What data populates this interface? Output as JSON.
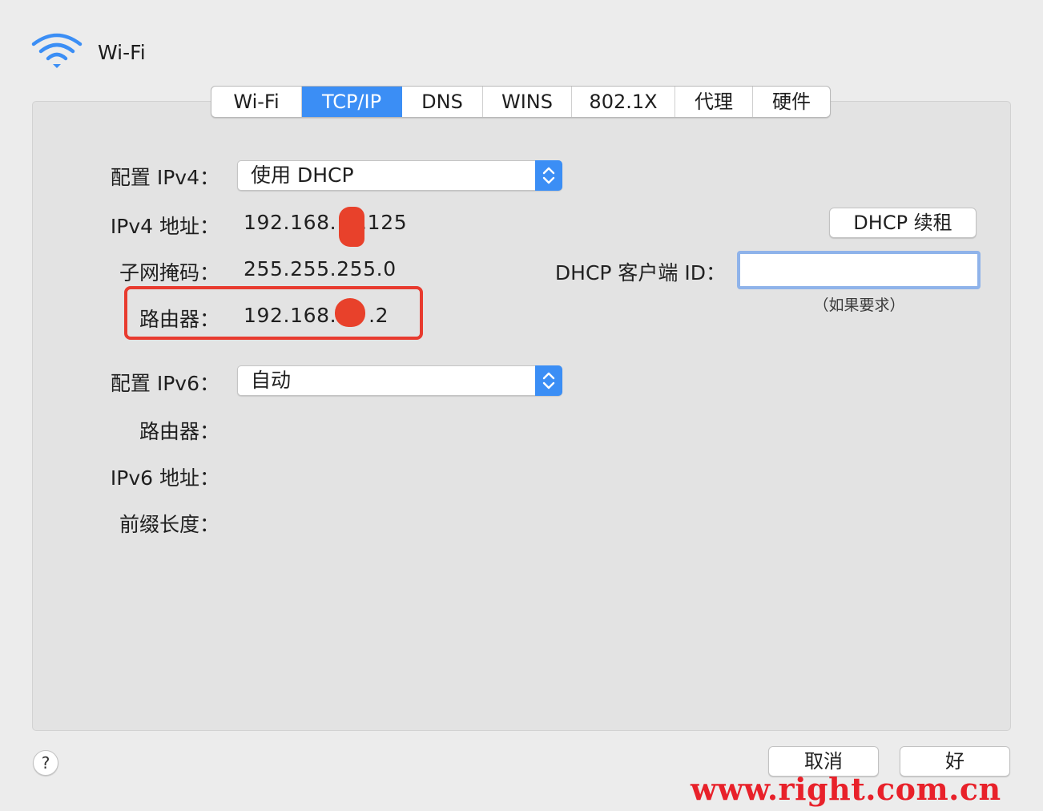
{
  "header": {
    "title": "Wi-Fi",
    "icon": "wifi-icon",
    "accent": "#3b8ef5"
  },
  "tabs": [
    {
      "label": "Wi-Fi",
      "active": false
    },
    {
      "label": "TCP/IP",
      "active": true
    },
    {
      "label": "DNS",
      "active": false
    },
    {
      "label": "WINS",
      "active": false
    },
    {
      "label": "802.1X",
      "active": false
    },
    {
      "label": "代理",
      "active": false
    },
    {
      "label": "硬件",
      "active": false
    }
  ],
  "ipv4": {
    "configure_label": "配置 IPv4：",
    "configure_value": "使用 DHCP",
    "address_label": "IPv4 地址：",
    "address_prefix": "192.168.",
    "address_suffix": ".125",
    "subnet_label": "子网掩码：",
    "subnet_value": "255.255.255.0",
    "router_label": "路由器：",
    "router_prefix": "192.168.",
    "router_suffix": ".2"
  },
  "dhcp": {
    "renew_button": "DHCP 续租",
    "client_id_label": "DHCP 客户端 ID：",
    "client_id_value": "",
    "client_id_hint": "（如果要求）"
  },
  "ipv6": {
    "configure_label": "配置 IPv6：",
    "configure_value": "自动",
    "router_label": "路由器：",
    "address_label": "IPv6 地址：",
    "prefix_label": "前缀长度："
  },
  "footer": {
    "help": "?",
    "cancel": "取消",
    "ok": "好"
  },
  "watermark": "www.right.com.cn",
  "colors": {
    "highlight": "#e83b2f",
    "redaction": "#e8412b",
    "watermark": "#e8212a"
  }
}
